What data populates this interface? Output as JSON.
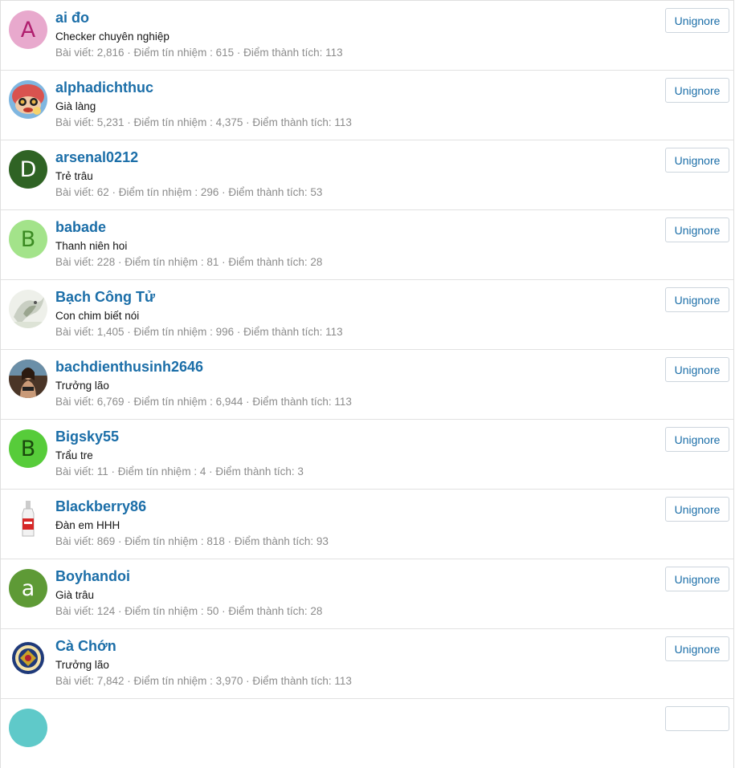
{
  "button_label": "Unignore",
  "members": [
    {
      "name": "ai đo",
      "title": "Checker chuyên nghiệp",
      "stats": "Bài viết: 2,816 · Điểm tín nhiệm : 615 · Điểm thành tích: 113",
      "avatar_letter": "A",
      "avatar_bg": "#e8a9cd",
      "avatar_fg": "#b0206f",
      "avatar_icon": "letter-avatar"
    },
    {
      "name": "alphadichthuc",
      "title": "Già làng",
      "stats": "Bài viết: 5,231 · Điểm tín nhiệm : 4,375 · Điểm thành tích: 113",
      "avatar_icon": "cartoon-character-avatar"
    },
    {
      "name": "arsenal0212",
      "title": "Trẻ trâu",
      "stats": "Bài viết: 62 · Điểm tín nhiệm : 296 · Điểm thành tích: 53",
      "avatar_letter": "D",
      "avatar_bg": "#2f6324",
      "avatar_fg": "#ffffff",
      "avatar_icon": "letter-avatar"
    },
    {
      "name": "babade",
      "title": "Thanh niên hoi",
      "stats": "Bài viết: 228 · Điểm tín nhiệm : 81 · Điểm thành tích: 28",
      "avatar_letter": "B",
      "avatar_bg": "#a3e38a",
      "avatar_fg": "#3b8a22",
      "avatar_icon": "letter-avatar"
    },
    {
      "name": "Bạch Công Tử",
      "title": "Con chim biết nói",
      "stats": "Bài viết: 1,405 · Điểm tín nhiệm : 996 · Điểm thành tích: 113",
      "avatar_icon": "bird-photo-avatar"
    },
    {
      "name": "bachdienthusinh2646",
      "title": "Trưởng lão",
      "stats": "Bài viết: 6,769 · Điểm tín nhiệm : 6,944 · Điểm thành tích: 113",
      "avatar_icon": "person-photo-avatar"
    },
    {
      "name": "Bigsky55",
      "title": "Trẩu tre",
      "stats": "Bài viết: 11 · Điểm tín nhiệm : 4 · Điểm thành tích: 3",
      "avatar_letter": "B",
      "avatar_bg": "#57cc3a",
      "avatar_fg": "#1a4a0d",
      "avatar_icon": "letter-avatar"
    },
    {
      "name": "Blackberry86",
      "title": "Đàn em HHH",
      "stats": "Bài viết: 869 · Điểm tín nhiệm : 818 · Điểm thành tích: 93",
      "avatar_icon": "bottle-avatar"
    },
    {
      "name": "Boyhandoi",
      "title": "Già trâu",
      "stats": "Bài viết: 124 · Điểm tín nhiệm : 50 · Điểm thành tích: 28",
      "avatar_letter": "a",
      "avatar_bg": "#5e9a36",
      "avatar_fg": "#ffffff",
      "avatar_icon": "letter-avatar"
    },
    {
      "name": "Cà Chớn",
      "title": "Trưởng lão",
      "stats": "Bài viết: 7,842 · Điểm tín nhiệm : 3,970 · Điểm thành tích: 113",
      "avatar_icon": "seal-emblem-avatar"
    }
  ],
  "partial_row": {
    "avatar_bg": "#5fc9c9"
  }
}
